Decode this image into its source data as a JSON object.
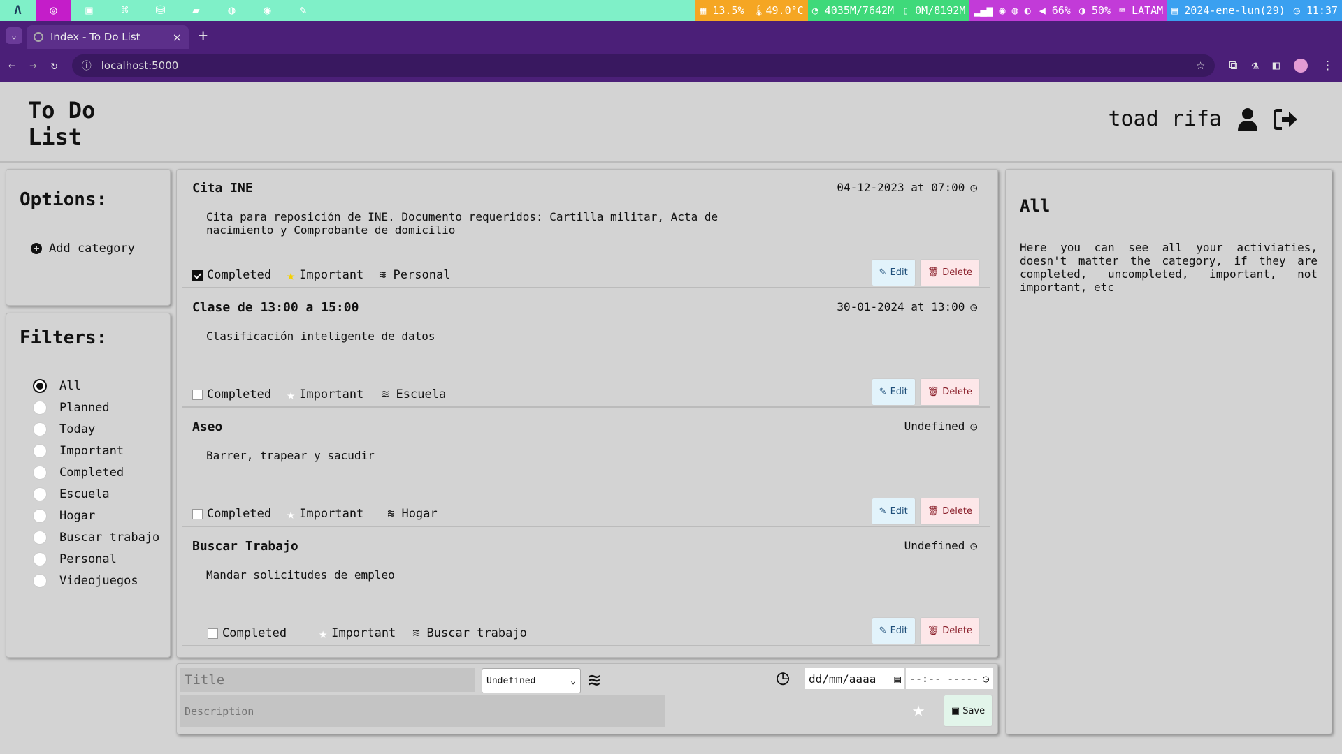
{
  "system_bar": {
    "cpu": "13.5%",
    "temp": "49.0°C",
    "memory": "4035M/7642M",
    "swap": "0M/8192M",
    "volume": "66%",
    "brightness": "50%",
    "keyboard": "LATAM",
    "date": "2024-ene-lun(29)",
    "time": "11:37",
    "colors": {
      "bar": "#7ff0c8",
      "active_app": "#c41dc9",
      "cpu": "#f5a623",
      "mem": "#3fd97a",
      "battery": "#c23bd8",
      "clock": "#3aa0f0"
    }
  },
  "browser": {
    "tab_title": "Index - To Do List",
    "url": "localhost:5000",
    "new_tab": "+",
    "close_tab": "×",
    "tab_dropdown": "⌄"
  },
  "header": {
    "brand": "To Do List",
    "username": "toad rifa"
  },
  "options": {
    "title": "Options:",
    "add_category": "Add category"
  },
  "filters": {
    "title": "Filters:",
    "items": [
      "All",
      "Planned",
      "Today",
      "Important",
      "Completed",
      "Escuela",
      "Hogar",
      "Buscar trabajo",
      "Personal",
      "Videojuegos"
    ],
    "selected": "All"
  },
  "tasks": [
    {
      "title": "Cita INE",
      "when": "04-12-2023 at 07:00",
      "description": "Cita para reposición de INE. Documento requeridos: Cartilla militar, Acta de nacimiento y Comprobante de domicilio",
      "completed": true,
      "completed_label": "Completed",
      "important": true,
      "important_label": "Important",
      "category": "Personal",
      "edit": "Edit",
      "delete": "Delete"
    },
    {
      "title": "Clase de 13:00 a 15:00",
      "when": "30-01-2024 at 13:00",
      "description": "Clasificación inteligente de datos",
      "completed": false,
      "completed_label": "Completed",
      "important": false,
      "important_label": "Important",
      "category": "Escuela",
      "edit": "Edit",
      "delete": "Delete"
    },
    {
      "title": "Aseo",
      "when": "Undefined",
      "description": "Barrer, trapear y sacudir",
      "completed": false,
      "completed_label": "Completed",
      "important": false,
      "important_label": "Important",
      "category": "Hogar",
      "edit": "Edit",
      "delete": "Delete"
    },
    {
      "title": "Buscar Trabajo",
      "when": "Undefined",
      "description": "Mandar solicitudes de empleo",
      "completed": false,
      "completed_label": "Completed",
      "important": false,
      "important_label": "Important",
      "category": "Buscar trabajo",
      "edit": "Edit",
      "delete": "Delete"
    }
  ],
  "new_task_form": {
    "title_placeholder": "Title",
    "description_placeholder": "Description",
    "category_selected": "Undefined",
    "date_placeholder": "dd/mm/aaaa",
    "time_placeholder": "--:-- -----",
    "save": "Save"
  },
  "info_panel": {
    "title": "All",
    "text": "Here you can see all your activiaties, doesn't matter the category, if they are completed, uncompleted, important, not important, etc"
  },
  "accent_colors": {
    "star_on": "#f5d000",
    "edit_bg": "#e2f3fb",
    "delete_bg": "#fde7e9",
    "save_bg": "#e2f5ea"
  }
}
